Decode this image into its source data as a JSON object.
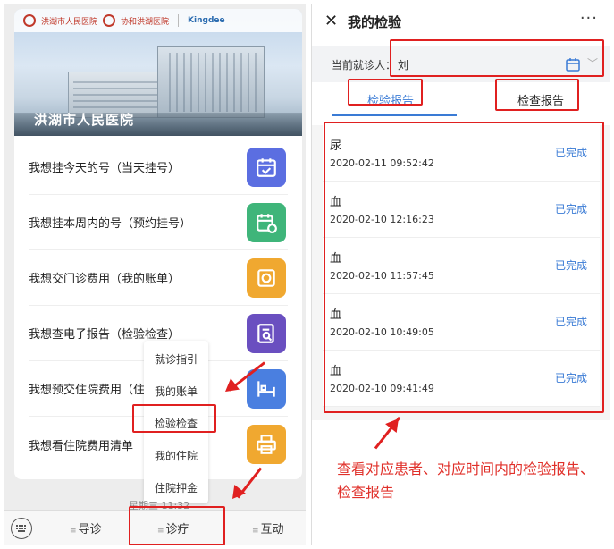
{
  "left": {
    "logos": [
      "洪湖市人民医院",
      "协和洪湖医院",
      "Kingdee"
    ],
    "hospital_name": "洪湖市人民医院",
    "menu": [
      {
        "label": "我想挂今天的号（当天挂号）",
        "icon": "calendar-check-icon",
        "color": "#5b6ee1"
      },
      {
        "label": "我想挂本周内的号（预约挂号）",
        "icon": "calendar-clock-icon",
        "color": "#3fb57a"
      },
      {
        "label": "我想交门诊费用（我的账单）",
        "icon": "wallet-icon",
        "color": "#f0a830"
      },
      {
        "label": "我想查电子报告（检验检查）",
        "icon": "report-search-icon",
        "color": "#6a4fc0"
      },
      {
        "label": "我想预交住院费用（住",
        "icon": "hospital-bed-icon",
        "color": "#4a7fe0"
      },
      {
        "label": "我想看住院费用清单",
        "icon": "printer-icon",
        "color": "#f0a830"
      }
    ],
    "popup": [
      "就诊指引",
      "我的账单",
      "检验检查",
      "我的住院",
      "住院押金"
    ],
    "time": "星期三 11:32",
    "tabbar": [
      "导诊",
      "诊疗",
      "互动"
    ]
  },
  "right": {
    "title": "我的检验",
    "more": "···",
    "patient_label": "当前就诊人：",
    "patient_name": "刘",
    "tabs": [
      "检验报告",
      "检查报告"
    ],
    "records": [
      {
        "kind": "尿",
        "datetime": "2020-02-11 09:52:42",
        "status": "已完成"
      },
      {
        "kind": "血",
        "datetime": "2020-02-10 12:16:23",
        "status": "已完成"
      },
      {
        "kind": "血",
        "datetime": "2020-02-10 11:57:45",
        "status": "已完成"
      },
      {
        "kind": "血",
        "datetime": "2020-02-10 10:49:05",
        "status": "已完成"
      },
      {
        "kind": "血",
        "datetime": "2020-02-10 09:41:49",
        "status": "已完成"
      }
    ],
    "note": "查看对应患者、对应时间内的检验报告、检查报告"
  },
  "colors": {
    "accent": "#3a7bd5",
    "annotation": "#e02020"
  }
}
